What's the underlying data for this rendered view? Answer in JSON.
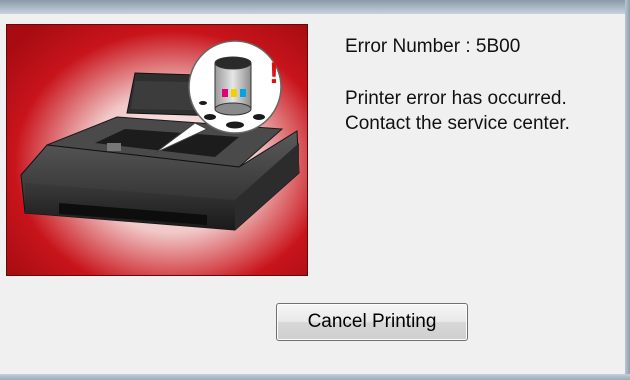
{
  "dialog": {
    "error_number_label": "Error Number : 5B00",
    "message_line1": "Printer error has occurred.",
    "message_line2": "Contact the service center.",
    "cancel_label": "Cancel Printing"
  },
  "illustration": {
    "icon": "printer-ink-absorber-full-icon",
    "alert_mark": "!",
    "background_color": "#c8141b",
    "alert_color": "#e01010"
  }
}
